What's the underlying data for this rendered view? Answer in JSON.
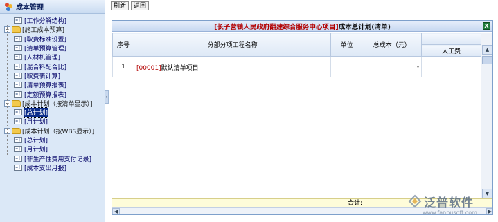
{
  "sidebar": {
    "title": "成本管理",
    "tree": [
      {
        "label": "[工作分解结构]",
        "type": "doc",
        "level": 1
      },
      {
        "label": "[施工成本预算]",
        "type": "folder",
        "level": 0,
        "expanded": true
      },
      {
        "label": "[取费标准设置]",
        "type": "doc",
        "level": 2
      },
      {
        "label": "[清单预算管理]",
        "type": "doc",
        "level": 2
      },
      {
        "label": "[人材机管理]",
        "type": "doc",
        "level": 2
      },
      {
        "label": "[混合料配合比]",
        "type": "doc",
        "level": 2
      },
      {
        "label": "[取费表计算]",
        "type": "doc",
        "level": 2
      },
      {
        "label": "[清单预算报表]",
        "type": "doc",
        "level": 2
      },
      {
        "label": "[定额预算报表]",
        "type": "doc",
        "level": 2
      },
      {
        "label": "[成本计划（按清单显示）]",
        "type": "folder",
        "level": 0,
        "expanded": true
      },
      {
        "label": "[总计划]",
        "type": "doc",
        "level": 2,
        "selected": true
      },
      {
        "label": "[月计划]",
        "type": "doc",
        "level": 2
      },
      {
        "label": "[成本计划（按WBS显示）]",
        "type": "folder",
        "level": 0,
        "expanded": true
      },
      {
        "label": "[总计划]",
        "type": "doc",
        "level": 2
      },
      {
        "label": "[月计划]",
        "type": "doc",
        "level": 2
      },
      {
        "label": "[非生产性费用支付记录]",
        "type": "doc",
        "level": 1
      },
      {
        "label": "[成本支出月报]",
        "type": "doc",
        "level": 1
      }
    ]
  },
  "toolbar": {
    "refresh_label": "刷新",
    "back_label": "返回"
  },
  "panel": {
    "project_name": "[长子营镇人民政府翻建综合服务中心项目]",
    "plan_title": "成本总计划(清单)",
    "columns": {
      "seq": "序号",
      "name": "分部分项工程名称",
      "unit": "单位",
      "total_cost": "总成本（元）",
      "labor_cost": "人工费"
    },
    "rows": [
      {
        "seq": "1",
        "code": "[00001]",
        "name": "默认清单项目",
        "unit": "",
        "total_cost": "-",
        "labor_cost": ""
      }
    ],
    "total_label": "合计:"
  },
  "watermark": {
    "text": "泛普软件",
    "url": "www.fanpusoft.com"
  },
  "colors": {
    "project_red": "#b30000",
    "header_blue": "#c7d8f1",
    "selected": "#0b2d8a"
  }
}
